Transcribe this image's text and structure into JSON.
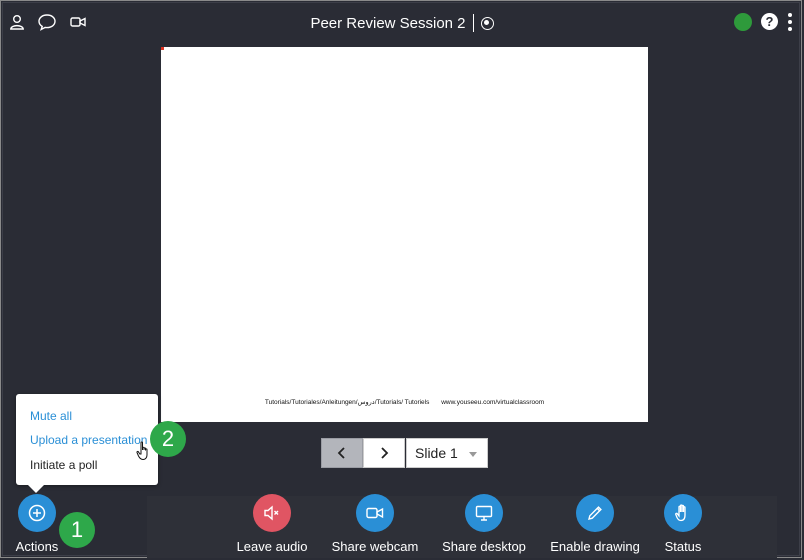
{
  "header": {
    "title": "Peer Review Session 2",
    "icons": [
      "user-icon",
      "chat-icon",
      "camera-icon",
      "record-icon",
      "help-icon",
      "more-icon"
    ],
    "help_glyph": "?",
    "status_color": "#2e9a3b"
  },
  "slide": {
    "footer_left": "Tutorials/Tutoriales/Anleitungen/دروس/Tutorials/ Tutoriels",
    "footer_right": "www.youseeu.com/virtualclassroom",
    "selector_value": "Slide 1"
  },
  "actions_menu": {
    "items": [
      {
        "label": "Mute all"
      },
      {
        "label": "Upload a presentation"
      },
      {
        "label": "Initiate a poll"
      }
    ]
  },
  "annotations": {
    "badge_1": "1",
    "badge_2": "2",
    "color": "#2ea84a"
  },
  "toolbar": {
    "actions_label": "Actions",
    "leave_audio": "Leave audio",
    "share_webcam": "Share webcam",
    "share_desktop": "Share desktop",
    "enable_drawing": "Enable drawing",
    "status": "Status"
  },
  "colors": {
    "background": "#2a2c35",
    "accent": "#2a8fd6",
    "danger": "#e05563"
  }
}
